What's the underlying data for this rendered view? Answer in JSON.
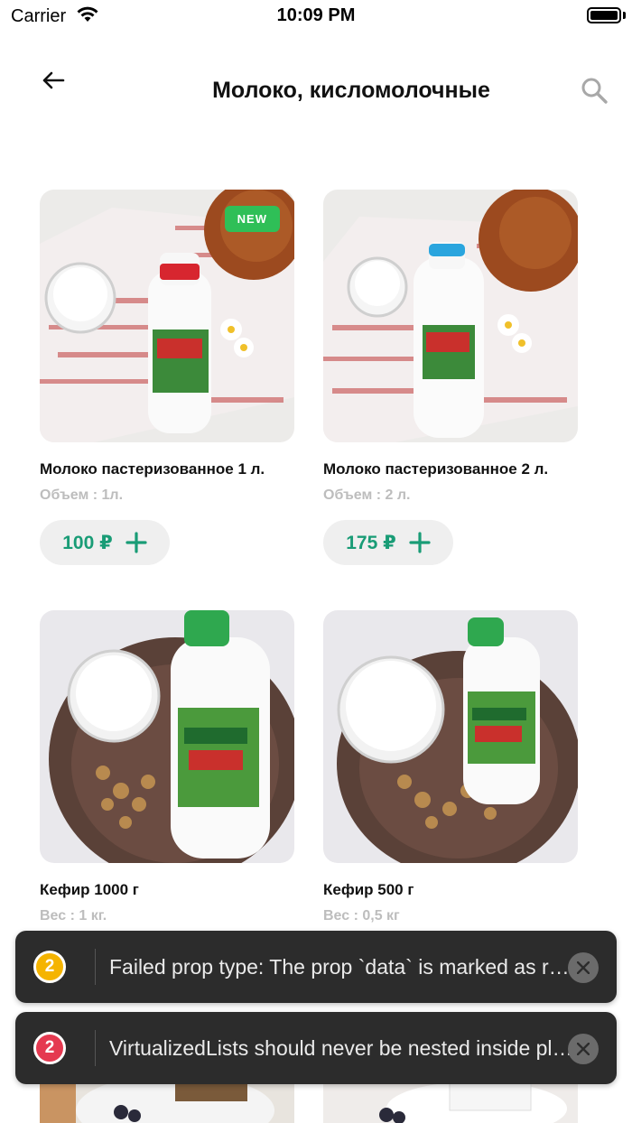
{
  "status_bar": {
    "carrier": "Carrier",
    "time": "10:09 PM",
    "battery_level": 1.0
  },
  "header": {
    "back_icon": "arrow-left-icon",
    "title": "Молоко, кисломолочные",
    "search_icon": "search-icon"
  },
  "products": [
    {
      "title": "Молоко пастеризованное 1 л.",
      "meta": "Объем : 1л.",
      "price": "100 ₽",
      "badge": "NEW",
      "image": "milk bottle with red cap"
    },
    {
      "title": "Молоко пастеризованное 2 л.",
      "meta": "Объем : 2 л.",
      "price": "175 ₽",
      "image": "milk bottle with blue cap"
    },
    {
      "title": "Кефир 1000 г",
      "meta": "Вес : 1 кг.",
      "image": "kefir bottle with green cap"
    },
    {
      "title": "Кефир 500 г",
      "meta": "Вес : 0,5 кг",
      "image": "small kefir bottle with green cap"
    }
  ],
  "toasts": [
    {
      "count": "2",
      "count_color": "#f5b400",
      "message": "Failed prop type: The prop `data` is marked as required in `VirtualizedList`, but its value is `undefined`."
    },
    {
      "count": "2",
      "count_color": "#e53950",
      "message": "VirtualizedLists should never be nested inside plain ScrollViews with the same orientation."
    }
  ],
  "colors": {
    "accent": "#199c76",
    "badge_new": "#2fbf57",
    "toast_bg": "#2c2c2c"
  }
}
